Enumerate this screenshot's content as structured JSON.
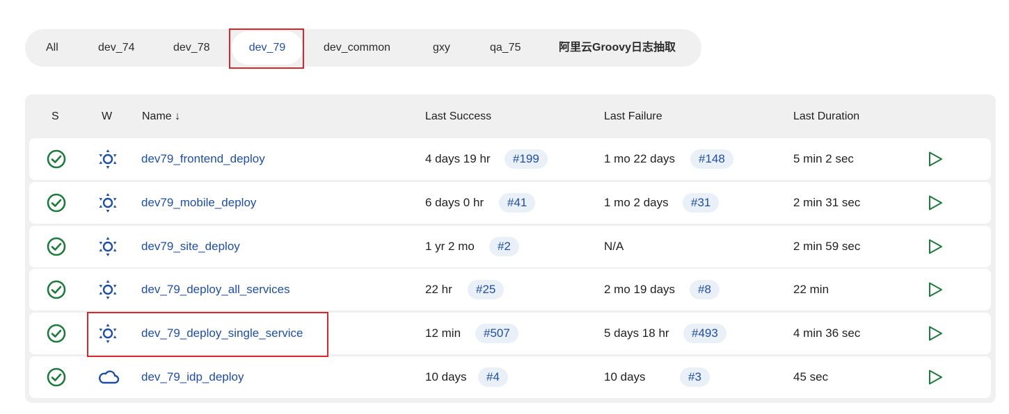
{
  "tabs": {
    "items": [
      "All",
      "dev_74",
      "dev_78",
      "dev_79",
      "dev_common",
      "gxy",
      "qa_75",
      "阿里云Groovy日志抽取"
    ],
    "active": "dev_79"
  },
  "table": {
    "headers": {
      "status": "S",
      "weather": "W",
      "name": "Name ↓",
      "last_success": "Last Success",
      "last_failure": "Last Failure",
      "last_duration": "Last Duration"
    },
    "rows": [
      {
        "name": "dev79_frontend_deploy",
        "success_time": "4 days 19 hr",
        "success_build": "#199",
        "failure_time": "1 mo 22 days",
        "failure_build": "#148",
        "duration": "5 min 2 sec",
        "weather_icon": "sun-icon"
      },
      {
        "name": "dev79_mobile_deploy",
        "success_time": "6 days 0 hr",
        "success_build": "#41",
        "failure_time": "1 mo 2 days",
        "failure_build": "#31",
        "duration": "2 min 31 sec",
        "weather_icon": "sun-icon"
      },
      {
        "name": "dev79_site_deploy",
        "success_time": "1 yr 2 mo",
        "success_build": "#2",
        "failure_time": "N/A",
        "failure_build": "",
        "duration": "2 min 59 sec",
        "weather_icon": "sun-icon"
      },
      {
        "name": "dev_79_deploy_all_services",
        "success_time": "22 hr",
        "success_build": "#25",
        "failure_time": "2 mo 19 days",
        "failure_build": "#8",
        "duration": "22 min",
        "weather_icon": "sun-icon"
      },
      {
        "name": "dev_79_deploy_single_service",
        "success_time": "12 min",
        "success_build": "#507",
        "failure_time": "5 days 18 hr",
        "failure_build": "#493",
        "duration": "4 min 36 sec",
        "weather_icon": "sun-icon"
      },
      {
        "name": "dev_79_idp_deploy",
        "success_time": "10 days",
        "success_build": "#4",
        "failure_time": "10 days",
        "failure_build": "#3",
        "duration": "45 sec",
        "weather_icon": "cloud-icon"
      }
    ]
  },
  "colors": {
    "success": "#1e7a3c",
    "link": "#1f4ea1",
    "highlight": "#d9252b"
  }
}
